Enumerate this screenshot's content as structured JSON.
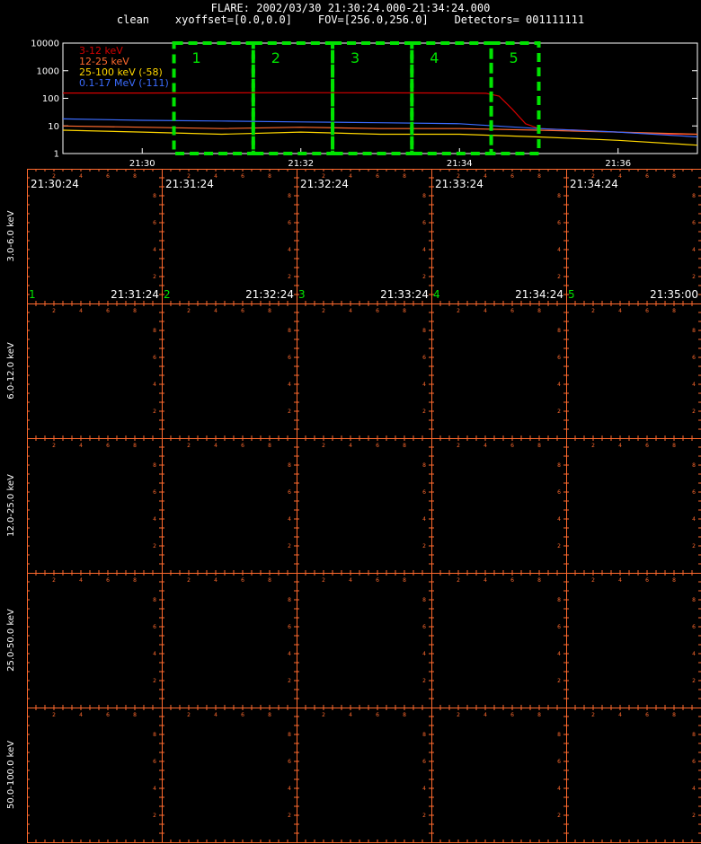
{
  "header": {
    "title": "FLARE: 2002/03/30 21:30:24.000-21:34:24.000",
    "params": "clean    xyoffset=[0.0,0.0]    FOV=[256.0,256.0]    Detectors= 001111111"
  },
  "chart_data": [
    {
      "type": "line",
      "title": "",
      "xlabel": "",
      "ylabel": "",
      "yscale": "log",
      "ylim": [
        1,
        10000
      ],
      "y_ticks": [
        "10000",
        "1000",
        "100",
        "10",
        "1"
      ],
      "x_range": [
        "21:29:00",
        "21:37:00"
      ],
      "x_ticks": [
        "21:30",
        "21:32",
        "21:34",
        "21:36"
      ],
      "grid": false,
      "legend_position": "top-left",
      "series": [
        {
          "name": "3-12 keV",
          "color": "#d40000",
          "x": [
            "21:29:00",
            "21:30:00",
            "21:31:00",
            "21:32:00",
            "21:33:00",
            "21:34:00",
            "21:34:20",
            "21:34:30",
            "21:34:40",
            "21:34:50",
            "21:35:00",
            "21:35:30",
            "21:36:00",
            "21:36:30",
            "21:37:00"
          ],
          "values": [
            155,
            155,
            158,
            160,
            158,
            155,
            152,
            120,
            40,
            12,
            8,
            7,
            6,
            5,
            5
          ]
        },
        {
          "name": "12-25 keV",
          "color": "#ff6a2e",
          "x": [
            "21:29:00",
            "21:30:00",
            "21:31:00",
            "21:32:00",
            "21:33:00",
            "21:34:00",
            "21:35:00",
            "21:36:00",
            "21:37:00"
          ],
          "values": [
            10,
            9,
            8,
            9,
            8,
            8,
            7,
            6,
            5
          ]
        },
        {
          "name": "25-100 keV (-58)",
          "color": "#ffd700",
          "x": [
            "21:29:00",
            "21:30:00",
            "21:31:00",
            "21:32:00",
            "21:33:00",
            "21:34:00",
            "21:35:00",
            "21:36:00",
            "21:37:00"
          ],
          "values": [
            7,
            6,
            5,
            6,
            5,
            5,
            4,
            3,
            2
          ]
        },
        {
          "name": "0.1-17 MeV (-111)",
          "color": "#3b6cff",
          "x": [
            "21:29:00",
            "21:30:00",
            "21:31:00",
            "21:32:00",
            "21:33:00",
            "21:34:00",
            "21:35:00",
            "21:36:00",
            "21:37:00"
          ],
          "values": [
            18,
            16,
            15,
            14,
            13,
            12,
            8,
            6,
            4
          ]
        }
      ],
      "intervals": [
        {
          "label": "1",
          "start": "21:30:24",
          "end": "21:31:24"
        },
        {
          "label": "2",
          "start": "21:31:24",
          "end": "21:32:24"
        },
        {
          "label": "3",
          "start": "21:32:24",
          "end": "21:33:24"
        },
        {
          "label": "4",
          "start": "21:33:24",
          "end": "21:34:24"
        },
        {
          "label": "5",
          "start": "21:34:24",
          "end": "21:35:00"
        }
      ]
    },
    {
      "type": "image_grid",
      "columns": [
        {
          "label": "1",
          "start": "21:30:24",
          "end": "21:31:24"
        },
        {
          "label": "2",
          "start": "21:31:24",
          "end": "21:32:24"
        },
        {
          "label": "3",
          "start": "21:32:24",
          "end": "21:33:24"
        },
        {
          "label": "4",
          "start": "21:33:24",
          "end": "21:34:24"
        },
        {
          "label": "5",
          "start": "21:34:24",
          "end": "21:35:00"
        }
      ],
      "rows": [
        "3.0-6.0 keV",
        "6.0-12.0 keV",
        "12.0-25.0 keV",
        "25.0-50.0 keV",
        "50.0-100.0 keV"
      ],
      "axis_tick_labels": [
        "2",
        "4",
        "6",
        "8"
      ]
    }
  ],
  "colors": {
    "background": "#000000",
    "frame": "#ff6a2e",
    "interval_box": "#00e400",
    "text": "#ffffff"
  }
}
